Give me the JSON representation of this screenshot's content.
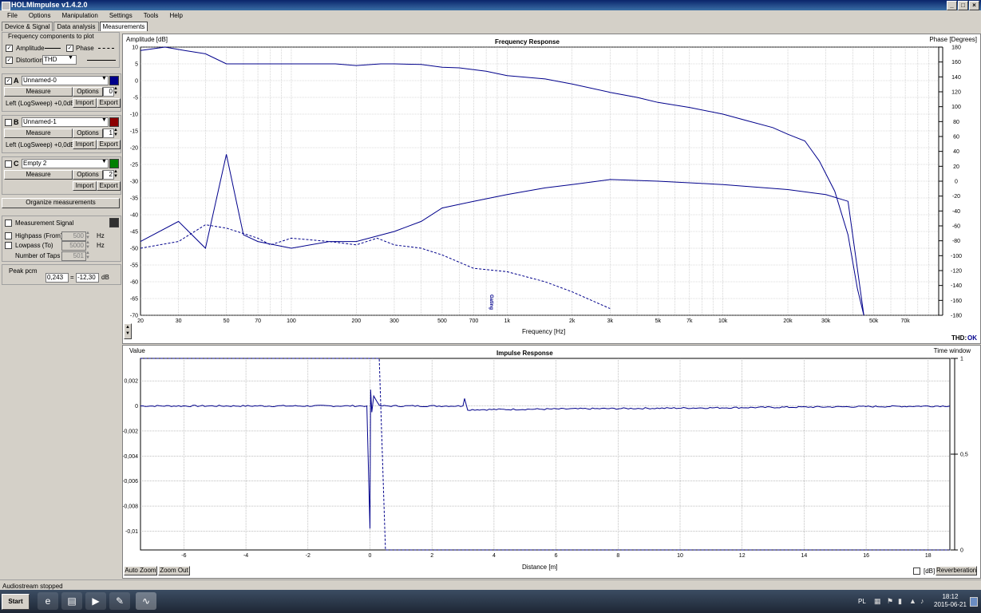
{
  "window": {
    "title": "HOLMImpulse  v1.4.2.0",
    "controls": [
      "_",
      "□",
      "×"
    ]
  },
  "menu": [
    "File",
    "Options",
    "Manipulation",
    "Settings",
    "Tools",
    "Help"
  ],
  "tabs": [
    {
      "label": "Device & Signal",
      "active": false
    },
    {
      "label": "Data analysis",
      "active": false
    },
    {
      "label": "Measurements",
      "active": true
    }
  ],
  "freq_components": {
    "legend": "Frequency components to plot",
    "amplitude_label": "Amplitude",
    "amplitude_checked": true,
    "phase_label": "Phase",
    "phase_checked": true,
    "distortion_label": "Distortion",
    "distortion_checked": true,
    "distortion_value": "THD"
  },
  "measurements": [
    {
      "letter": "A",
      "checked": true,
      "name": "Unnamed-0",
      "color": "#00008b",
      "measure": "Measure",
      "options": "Options",
      "spin": "0",
      "info": "Left (LogSweep) +0,0dB",
      "import": "Import",
      "export": "Export"
    },
    {
      "letter": "B",
      "checked": false,
      "name": "Unnamed-1",
      "color": "#8b0000",
      "measure": "Measure",
      "options": "Options",
      "spin": "1",
      "info": "Left (LogSweep) +0,0dB",
      "import": "Import",
      "export": "Export"
    },
    {
      "letter": "C",
      "checked": false,
      "name": "Empty 2",
      "color": "#008000",
      "measure": "Measure",
      "options": "Options",
      "spin": "2",
      "info": "",
      "import": "Import",
      "export": "Export"
    }
  ],
  "organize_label": "Organize measurements",
  "signal": {
    "label": "Measurement Signal",
    "highpass_label": "Highpass (From)",
    "highpass_value": "500",
    "highpass_unit": "Hz",
    "lowpass_label": "Lowpass (To)",
    "lowpass_value": "5000",
    "lowpass_unit": "Hz",
    "taps_label": "Number of Taps",
    "taps_value": "501"
  },
  "peak": {
    "label": "Peak pcm",
    "value": "0,243",
    "eq": "=",
    "db_value": "-12,30",
    "db_unit": "dB"
  },
  "freq_chart": {
    "title": "Frequency Response",
    "ylabel": "Amplitude [dB]",
    "y2label": "Phase [Degrees]",
    "xlabel": "Frequency [Hz]",
    "status_label": "THD:",
    "status_value": "OK",
    "annotation": "Gating"
  },
  "impulse_chart": {
    "title": "Impulse Response",
    "ylabel": "Value",
    "y2label": "Time window",
    "xlabel": "Distance [m]",
    "auto_zoom": "Auto Zoom",
    "zoom_out": "Zoom Out",
    "db_label": "[dB]",
    "db_checked": false,
    "reverb_label": "Reverberation"
  },
  "chart_data": [
    {
      "type": "line",
      "title": "Frequency Response",
      "xlabel": "Frequency [Hz]",
      "ylabel": "Amplitude [dB]",
      "y2label": "Phase [Degrees]",
      "xscale": "log",
      "xlim": [
        20,
        100000
      ],
      "ylim": [
        -70,
        10
      ],
      "y2lim": [
        -180,
        180
      ],
      "xticks": [
        20,
        30,
        50,
        70,
        100,
        200,
        300,
        500,
        700,
        1000,
        2000,
        3000,
        5000,
        7000,
        10000,
        20000,
        30000,
        50000,
        70000
      ],
      "xtick_labels": [
        "20",
        "30",
        "50",
        "70",
        "100",
        "200",
        "300",
        "500",
        "700",
        "1k",
        "2k",
        "3k",
        "5k",
        "7k",
        "10k",
        "20k",
        "30k",
        "50k",
        "70k"
      ],
      "yticks": [
        10,
        5,
        0,
        -5,
        -10,
        -15,
        -20,
        -25,
        -30,
        -35,
        -40,
        -45,
        -50,
        -55,
        -60,
        -65,
        -70
      ],
      "y2ticks": [
        180,
        160,
        140,
        120,
        100,
        80,
        60,
        40,
        20,
        0,
        -20,
        -40,
        -60,
        -80,
        -100,
        -120,
        -140,
        -160,
        -180
      ],
      "grid": true,
      "color": "#00008b",
      "series": [
        {
          "style": "solid",
          "x": [
            20,
            26,
            32,
            40,
            50,
            60,
            80,
            100,
            130,
            160,
            200,
            260,
            300,
            400,
            500,
            600,
            800,
            1000,
            1500,
            2000,
            3000,
            4000,
            5000,
            7000,
            10000,
            13000,
            17000,
            20000,
            24000,
            28000,
            33000,
            38000,
            42000,
            45000
          ],
          "y": [
            9,
            10,
            9,
            8,
            5,
            5,
            5,
            5,
            5,
            5,
            4.5,
            5,
            5,
            4.8,
            4,
            3.8,
            2.8,
            1.5,
            0.5,
            -1,
            -3.5,
            -5,
            -6.5,
            -8,
            -10,
            -12,
            -14,
            -16,
            -18,
            -24,
            -33,
            -46,
            -62,
            -70
          ]
        },
        {
          "style": "dashed",
          "x": [
            20,
            30,
            40,
            50,
            70,
            80,
            100,
            150,
            200,
            250,
            300,
            400,
            500,
            700,
            1000,
            1500,
            2000,
            3000
          ],
          "y": [
            -50,
            -48,
            -43,
            -44,
            -47,
            -49,
            -47,
            -48,
            -49,
            -47,
            -49,
            -50,
            -52,
            -56,
            -57,
            -60,
            -63,
            -68
          ]
        },
        {
          "style": "solid",
          "x": [
            20,
            30,
            40,
            50,
            60,
            70,
            100,
            150,
            200,
            300,
            400,
            500,
            700,
            1000,
            1500,
            2000,
            3000,
            5000,
            10000,
            20000,
            30000,
            38000,
            45000
          ],
          "y": [
            -48,
            -42,
            -50,
            -22,
            -46,
            -48,
            -50,
            -48,
            -48,
            -45,
            -42,
            -38,
            -36,
            -34,
            -32,
            -31,
            -29.5,
            -30,
            -31,
            -32.5,
            -34,
            -36,
            -70
          ]
        }
      ]
    },
    {
      "type": "line",
      "title": "Impulse Response",
      "xlabel": "Distance [m]",
      "ylabel": "Value",
      "y2label": "Time window",
      "xlim": [
        -7.4,
        18.7
      ],
      "ylim": [
        -0.0115,
        0.0038
      ],
      "y2lim": [
        0,
        1
      ],
      "xticks": [
        -6,
        -4,
        -2,
        0,
        2,
        4,
        6,
        8,
        10,
        12,
        14,
        16,
        18
      ],
      "yticks": [
        0.002,
        0,
        -0.002,
        -0.004,
        -0.006,
        -0.008,
        -0.01
      ],
      "ytick_labels": [
        "0,002",
        "0",
        "-0,002",
        "-0,004",
        "-0,006",
        "-0,008",
        "-0,01"
      ],
      "y2ticks": [
        1,
        0.5,
        0
      ],
      "y2tick_labels": [
        "1",
        "0,5",
        "0"
      ],
      "grid": true,
      "color": "#00008b",
      "series": [
        {
          "style": "solid",
          "x": [
            -7.4,
            -0.1,
            0,
            0.02,
            0.06,
            0.12,
            0.3,
            3.0,
            3.05,
            3.15,
            18.7
          ],
          "y": [
            0,
            0,
            -0.0098,
            0.0013,
            -0.0005,
            0.0008,
            0,
            0,
            0.0006,
            -0.0003,
            0
          ]
        },
        {
          "style": "dashed",
          "x": [
            -7.4,
            0.3,
            0.5,
            18.7
          ],
          "y2": [
            1,
            1,
            0,
            0
          ]
        }
      ]
    }
  ],
  "status_text": "Audiostream stopped",
  "taskbar": {
    "start_label": "Start",
    "tray_lang": "PL",
    "clock_time": "18:12",
    "clock_date": "2015-06-21"
  }
}
